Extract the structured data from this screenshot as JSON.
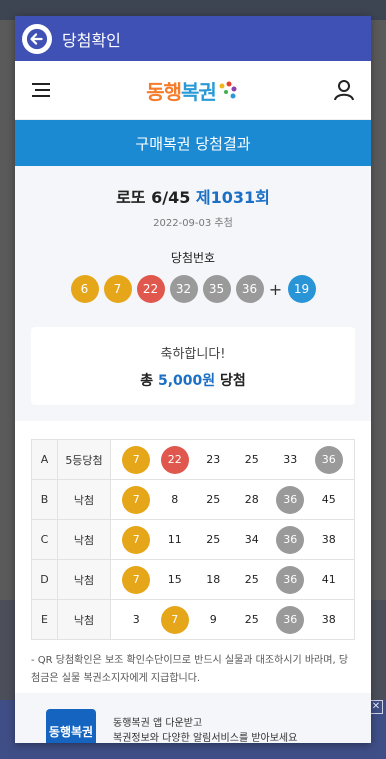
{
  "dialog": {
    "title": "당첨확인"
  },
  "site": {
    "logo": {
      "part1": "동행",
      "part2": "복권"
    }
  },
  "banner": {
    "title": "구매복권 당첨결과"
  },
  "draw": {
    "game": "로또 6/45",
    "round": "제1031회",
    "date": "2022-09-03 추첨",
    "winning_label": "당첨번호",
    "numbers": [
      "6",
      "7",
      "22",
      "32",
      "35",
      "36"
    ],
    "plus": "+",
    "bonus": "19"
  },
  "result": {
    "message": "축하합니다!",
    "prefix": "총",
    "amount": "5,000원",
    "suffix": "당첨"
  },
  "tickets": [
    {
      "slot": "A",
      "status": "5등당첨",
      "numbers": [
        "7",
        "22",
        "23",
        "25",
        "33",
        "36"
      ]
    },
    {
      "slot": "B",
      "status": "낙첨",
      "numbers": [
        "7",
        "8",
        "25",
        "28",
        "36",
        "45"
      ]
    },
    {
      "slot": "C",
      "status": "낙첨",
      "numbers": [
        "7",
        "11",
        "25",
        "34",
        "36",
        "38"
      ]
    },
    {
      "slot": "D",
      "status": "낙첨",
      "numbers": [
        "7",
        "15",
        "18",
        "25",
        "36",
        "41"
      ]
    },
    {
      "slot": "E",
      "status": "낙첨",
      "numbers": [
        "3",
        "7",
        "9",
        "25",
        "36",
        "38"
      ]
    }
  ],
  "note": "- QR 당첨확인은 보조 확인수단이므로 반드시 실물과 대조하시기 바라며, 당첨금은 실물 복권소지자에게 지급합니다.",
  "promo": {
    "icon_text": "동행복권",
    "line1": "동행복권 앱 다운받고",
    "line2": "복권정보와 다양한 알림서비스를 받아보세요"
  },
  "ad": {
    "close_label": "✕"
  },
  "colors": {
    "header": "#3f51b5",
    "banner": "#1b8ad3",
    "ball_yellow": "#e6a61a",
    "ball_red": "#e0584d",
    "ball_gray": "#9a9a9a",
    "ball_blue": "#2a95d6"
  }
}
